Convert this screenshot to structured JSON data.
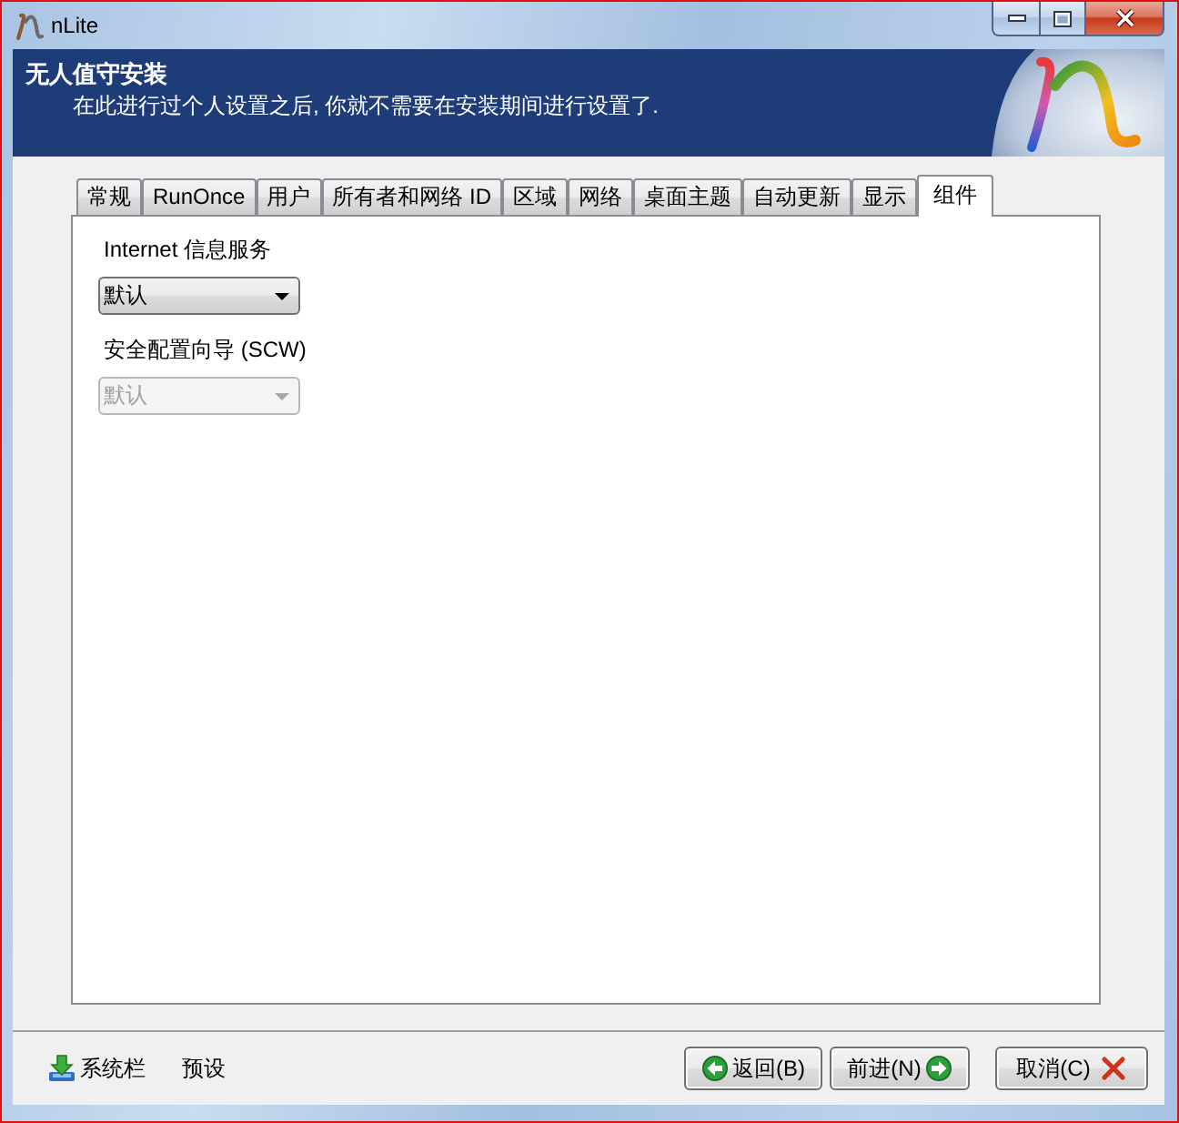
{
  "window": {
    "title": "nLite"
  },
  "header": {
    "title": "无人值守安装",
    "subtitle": "在此进行过个人设置之后, 你就不需要在安装期间进行设置了."
  },
  "tabs": [
    {
      "label": "常规",
      "selected": false
    },
    {
      "label": "RunOnce",
      "selected": false
    },
    {
      "label": "用户",
      "selected": false
    },
    {
      "label": "所有者和网络 ID",
      "selected": false
    },
    {
      "label": "区域",
      "selected": false
    },
    {
      "label": "网络",
      "selected": false
    },
    {
      "label": "桌面主题",
      "selected": false
    },
    {
      "label": "自动更新",
      "selected": false
    },
    {
      "label": "显示",
      "selected": false
    },
    {
      "label": "组件",
      "selected": true
    }
  ],
  "components": [
    {
      "label": "Internet 信息服务",
      "value": "默认",
      "disabled": false
    },
    {
      "label": "安全配置向导 (SCW)",
      "value": "默认",
      "disabled": true
    }
  ],
  "footer": {
    "links": [
      {
        "label": "系统栏",
        "kind": "tray"
      },
      {
        "label": "预设",
        "kind": "plain"
      }
    ],
    "buttons": [
      {
        "label": "返回(B)",
        "kind": "back"
      },
      {
        "label": "前进(N)",
        "kind": "next"
      },
      {
        "label": "取消(C)",
        "kind": "cancel"
      }
    ]
  }
}
